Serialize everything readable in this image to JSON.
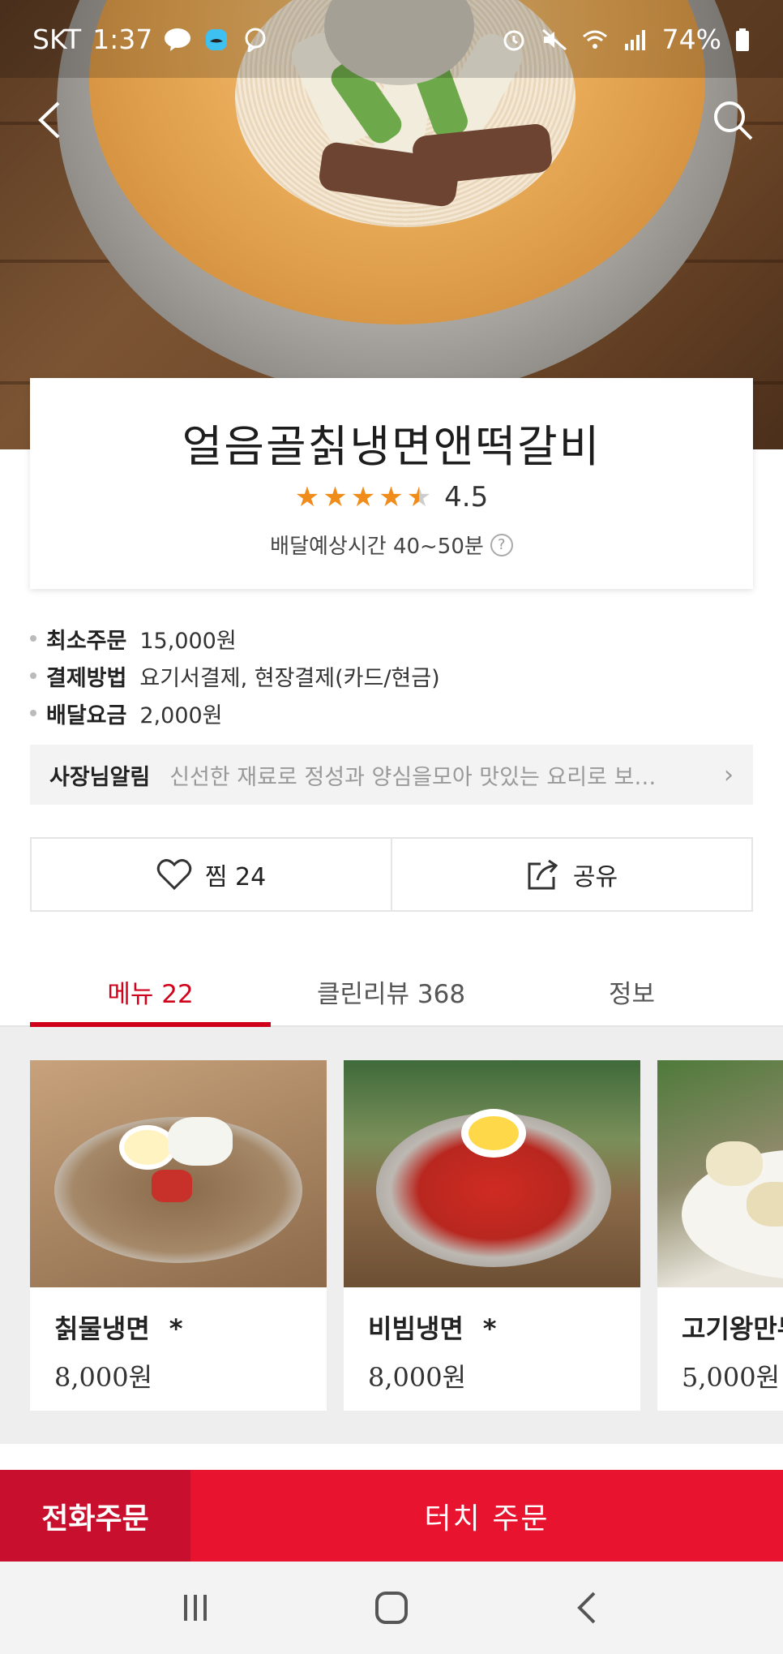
{
  "status_bar": {
    "carrier": "SKT",
    "time": "1:37",
    "battery": "74%",
    "left_icons": [
      "talk-icon",
      "mustache-icon",
      "chat-bubble-icon"
    ],
    "right_icons": [
      "alarm-icon",
      "mute-icon",
      "wifi-icon",
      "signal-icon",
      "battery-icon"
    ]
  },
  "header": {
    "back_icon": "back-arrow-icon",
    "search_icon": "search-icon"
  },
  "store": {
    "name": "얼음골칡냉면앤떡갈비",
    "rating": "4.5",
    "rating_value": 4.5,
    "eta": "배달예상시간 40~50분",
    "help_icon": "?"
  },
  "details": [
    {
      "label": "최소주문",
      "value": "15,000원"
    },
    {
      "label": "결제방법",
      "value": "요기서결제, 현장결제(카드/현금)"
    },
    {
      "label": "배달요금",
      "value": "2,000원"
    }
  ],
  "notice": {
    "label": "사장님알림",
    "text": "신선한 재료로 정성과 양심을모아 맛있는 요리로 보…"
  },
  "actions": {
    "like_label": "찜 24",
    "share_label": "공유"
  },
  "tabs": [
    {
      "label": "메뉴 22",
      "active": true
    },
    {
      "label": "클린리뷰 368",
      "active": false
    },
    {
      "label": "정보",
      "active": false
    }
  ],
  "menu_items": [
    {
      "name": "칡물냉면",
      "badge": "*",
      "price": "8,000원"
    },
    {
      "name": "비빔냉면",
      "badge": "*",
      "price": "8,000원"
    },
    {
      "name": "고기왕만두",
      "badge": "",
      "price": "5,000원"
    }
  ],
  "order_bar": {
    "phone_order": "전화주문",
    "touch_order": "터치 주문"
  },
  "colors": {
    "accent": "#d0021b",
    "star": "#f08d1a",
    "order_dark": "#c8102e",
    "order_main": "#e8142f"
  }
}
